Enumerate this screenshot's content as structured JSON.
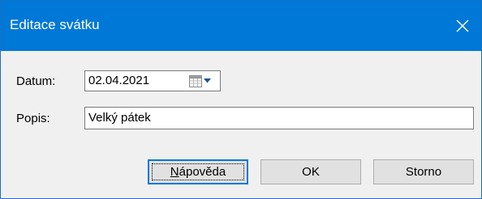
{
  "window": {
    "title": "Editace svátku",
    "accent_color": "#0078d7",
    "close_icon": "close-icon"
  },
  "form": {
    "date": {
      "label": "Datum:",
      "value": "02.04.2021",
      "picker_icon": "calendar-icon"
    },
    "description": {
      "label": "Popis:",
      "value": "Velký pátek"
    }
  },
  "buttons": {
    "help": {
      "mnemonic": "N",
      "rest": "ápověda"
    },
    "ok": {
      "label": "OK"
    },
    "cancel": {
      "label": "Storno"
    }
  }
}
